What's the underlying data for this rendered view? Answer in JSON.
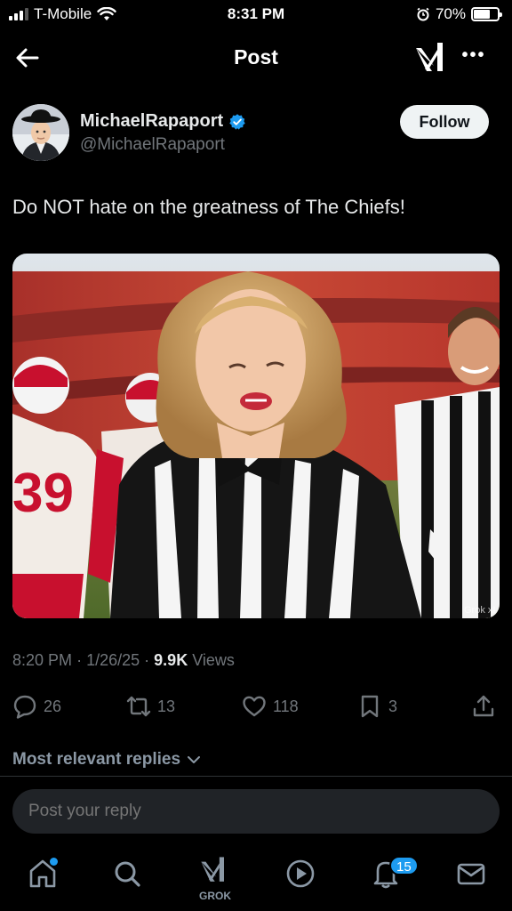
{
  "status_bar": {
    "carrier": "T-Mobile",
    "time": "8:31 PM",
    "battery": "70%",
    "battery_level": 0.7
  },
  "header": {
    "title": "Post",
    "back_icon": "arrow-left-icon",
    "grok_icon": "grok-icon",
    "more_icon": "more-icon"
  },
  "author": {
    "name": "MichaelRapaport",
    "handle": "@MichaelRapaport",
    "verified_icon": "verified-badge-icon",
    "follow_label": "Follow"
  },
  "post": {
    "text": "Do NOT hate on the greatness of The Chiefs!",
    "image_icon": "post-image",
    "image_watermark": "Grok xI",
    "time": "8:20 PM",
    "sep1": "·",
    "date": "1/26/25",
    "sep2": "·",
    "views_count": "9.9K",
    "views_label": "Views"
  },
  "actions": {
    "replies": "26",
    "reposts": "13",
    "likes": "118",
    "bookmarks": "3"
  },
  "replies": {
    "sort_label": "Most relevant replies",
    "placeholder": "Post your reply"
  },
  "nav": {
    "grok_label": "GROK",
    "notifications_badge": "15"
  },
  "colors": {
    "accent": "#1d9bf0",
    "background": "#000000",
    "muted": "#71767b",
    "chiefs_red": "#c8102e"
  }
}
